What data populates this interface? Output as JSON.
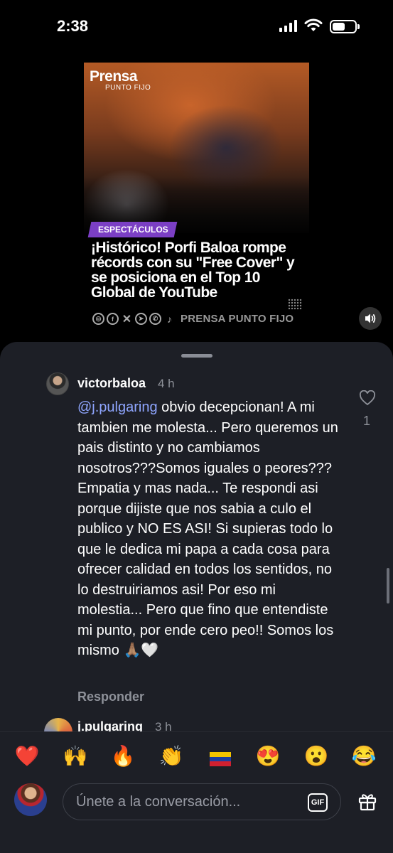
{
  "status_bar": {
    "time": "2:38",
    "battery_level": 0.55
  },
  "post": {
    "logo_main": "Prensa",
    "logo_sub": "PUNTO FIJO",
    "category_badge": "ESPECTÁCULOS",
    "headline": "¡Histórico! Porfi Baloa rompe récords con su \"Free Cover\" y se posiciona en el Top 10 Global de YouTube",
    "brand_footer": "PRENSA PUNTO FIJO",
    "social_icons": [
      "instagram-icon",
      "facebook-icon",
      "x-icon",
      "telegram-icon",
      "whatsapp-icon",
      "tiktok-icon"
    ]
  },
  "comments": [
    {
      "username": "victorbaloa",
      "time": "4 h",
      "mention": "@j.pulgaring",
      "text": " obvio decepcionan! A mi tambien me molesta... Pero queremos un pais distinto y no cambiamos nosotros???Somos iguales o peores??? Empatia y mas nada... Te respondi asi porque dijiste que nos sabia a culo el publico y NO ES ASI! Si supieras todo lo que le dedica mi papa a cada cosa para ofrecer calidad en todos los sentidos, no lo destruiriamos asi! Por eso mi molestia... Pero que fino que entendiste mi punto, por ende cero peo!! Somos los mismo 🙏🏽🤍",
      "like_count": "1",
      "reply_label": "Responder"
    },
    {
      "username": "j.pulgaring",
      "time": "3 h"
    }
  ],
  "reactions": [
    "❤️",
    "🙌",
    "🔥",
    "👏",
    "🇻🇪",
    "😍",
    "😮",
    "😂"
  ],
  "composer": {
    "placeholder": "Únete a la conversación...",
    "gif_label": "GIF"
  },
  "colors": {
    "sheet_bg": "#1d1f26",
    "mention": "#8fa6ff",
    "muted_text": "#8e9199",
    "badge": "#7b3fc4"
  }
}
